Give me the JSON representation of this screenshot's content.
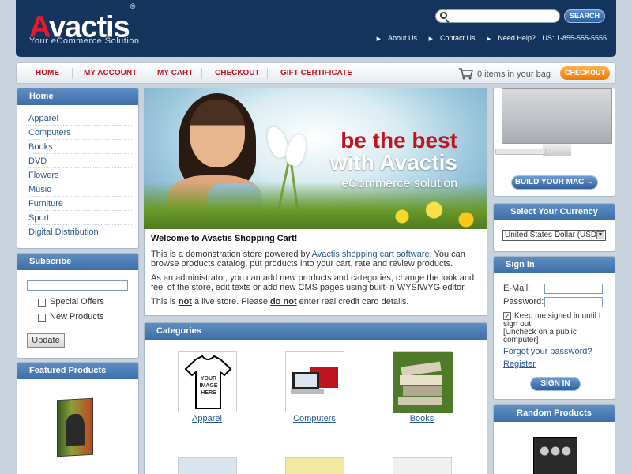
{
  "header": {
    "logo_a": "A",
    "logo_rest": "vactis",
    "logo_reg": "®",
    "tagline": "Your eCommerce Solution",
    "search_placeholder": "",
    "search_button": "SEARCH",
    "links": [
      "About Us",
      "Contact Us",
      "Need Help?"
    ],
    "phone": "US: 1-855-555-5555"
  },
  "nav": {
    "items": [
      "HOME",
      "MY ACCOUNT",
      "MY CART",
      "CHECKOUT",
      "GIFT CERTIFICATE"
    ],
    "cart_text": "0 items in your bag",
    "checkout_button": "CHECKOUT"
  },
  "left": {
    "home_title": "Home",
    "categories": [
      "Apparel",
      "Computers",
      "Books",
      "DVD",
      "Flowers",
      "Music",
      "Furniture",
      "Sport",
      "Digital Distribution"
    ],
    "subscribe_title": "Subscribe",
    "subscribe_options": [
      "Special Offers",
      "New Products"
    ],
    "update_button": "Update",
    "featured_title": "Featured Products"
  },
  "banner": {
    "line1": "be the best",
    "line2": "with Avactis",
    "line3": "eCommerce solution"
  },
  "welcome": {
    "title": "Welcome to Avactis Shopping Cart!",
    "p1_pre": "This is a demonstration store powered by ",
    "p1_link": "Avactis shopping cart software",
    "p1_post": ". You can browse products catalog, put products into your cart, rate and review products.",
    "p2": "As an administrator, you can add new products and categories, change the look and feel of the store, edit texts or add new CMS pages using built-in WYSIWYG editor.",
    "p3_a": "This is ",
    "p3_not": "not",
    "p3_b": " a live store. Please ",
    "p3_donot": "do not",
    "p3_c": " enter real credit card details."
  },
  "categories_box": {
    "title": "Categories",
    "items": [
      "Apparel",
      "Computers",
      "Books"
    ],
    "apparel_thumb_text": "YOUR IMAGE HERE"
  },
  "right": {
    "build_button": "BUILD YOUR MAC →",
    "currency_title": "Select Your Currency",
    "currency_value": "United States Dollar (USD)",
    "signin_title": "Sign In",
    "email_label": "E-Mail:",
    "password_label": "Password:",
    "keep_signed": "Keep me signed in until I sign out.",
    "uncheck_note": "[Uncheck on a public computer]",
    "forgot_link": "Forgot your password?",
    "register_link": "Register",
    "signin_button": "SIGN IN",
    "random_title": "Random Products"
  }
}
